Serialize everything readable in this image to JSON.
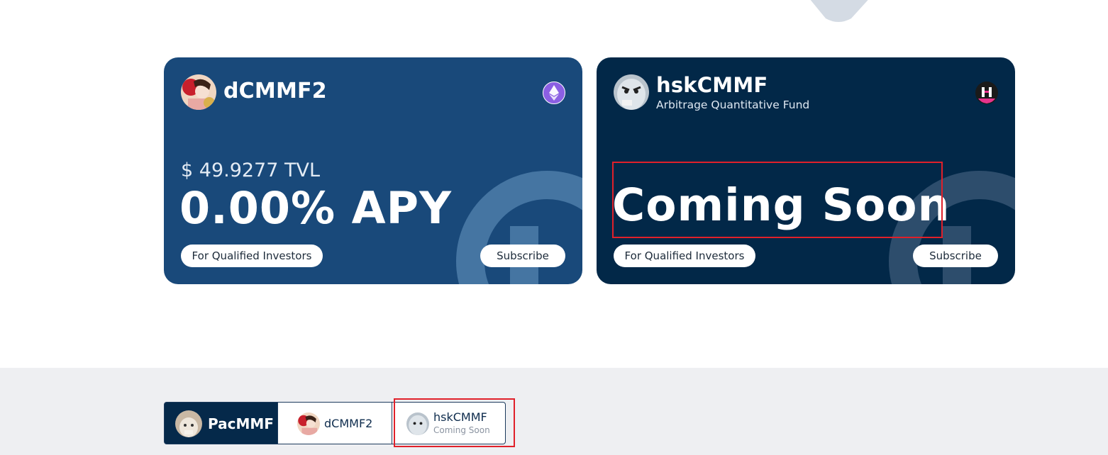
{
  "cards": [
    {
      "name": "dCMMF2",
      "chain_icon": "ethereum-icon",
      "tvl": "$ 49.9277 TVL",
      "apy": "0.00% APY",
      "investors_label": "For Qualified Investors",
      "subscribe_label": "Subscribe",
      "bg_color": "#19497a"
    },
    {
      "name": "hskCMMF",
      "subtitle": "Arbitrage Quantitative Fund",
      "chain_icon": "hashkey-icon",
      "status": "Coming Soon",
      "investors_label": "For Qualified Investors",
      "subscribe_label": "Subscribe",
      "bg_color": "#022848"
    }
  ],
  "tabs": [
    {
      "label": "PacMMF",
      "active": true
    },
    {
      "label": "dCMMF2"
    },
    {
      "label": "hskCMMF",
      "status": "Coming Soon"
    }
  ],
  "colors": {
    "annotation": "#e0202a",
    "band": "#eeeff2",
    "tab_active": "#05294a"
  }
}
